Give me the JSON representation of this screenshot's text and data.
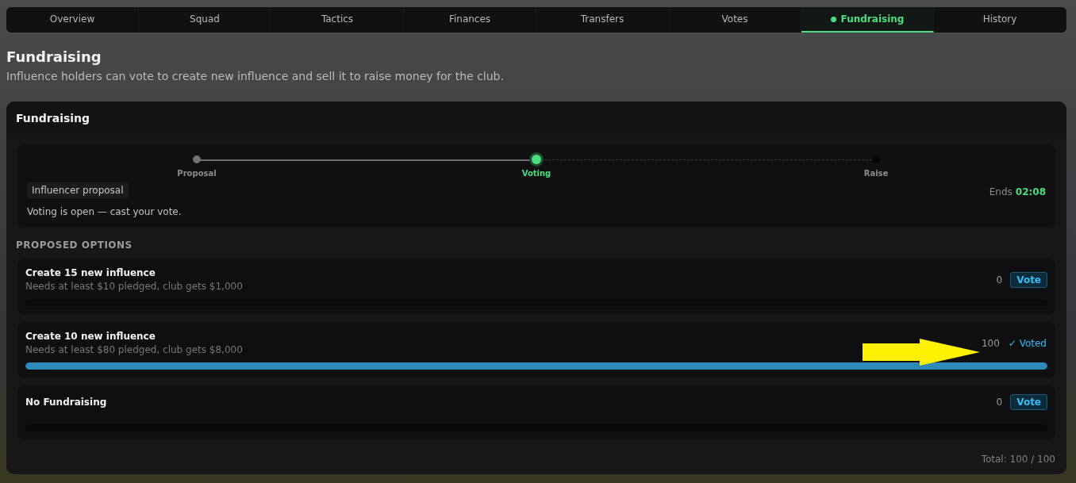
{
  "tabs": [
    {
      "label": "Overview",
      "selected": false,
      "dot": false
    },
    {
      "label": "Squad",
      "selected": false,
      "dot": false
    },
    {
      "label": "Tactics",
      "selected": false,
      "dot": false
    },
    {
      "label": "Finances",
      "selected": false,
      "dot": false
    },
    {
      "label": "Transfers",
      "selected": false,
      "dot": false
    },
    {
      "label": "Votes",
      "selected": false,
      "dot": false
    },
    {
      "label": "Fundraising",
      "selected": true,
      "dot": true
    },
    {
      "label": "History",
      "selected": false,
      "dot": false
    }
  ],
  "page": {
    "title": "Fundraising",
    "subtitle": "Influence holders can vote to create new influence and sell it to raise money for the club."
  },
  "card": {
    "title": "Fundraising",
    "stepper": {
      "steps": [
        {
          "label": "Proposal",
          "completed": true,
          "selected": false
        },
        {
          "label": "Voting",
          "completed": false,
          "selected": true
        },
        {
          "label": "Raise",
          "completed": false,
          "selected": false
        }
      ],
      "badge": "Influencer proposal",
      "ends_label": "Ends",
      "ends_time": "02:08",
      "status_text": "Voting is open — cast your vote."
    },
    "section_heading": "PROPOSED OPTIONS",
    "options": [
      {
        "title": "Create 15 new influence",
        "detail": "Needs at least $10 pledged, club gets $1,000",
        "count": "0",
        "action": "Vote",
        "voted": false,
        "level": 0
      },
      {
        "title": "Create 10 new influence",
        "detail": "Needs at least $80 pledged, club gets $8,000",
        "count": "100",
        "action": "✓ Voted",
        "voted": true,
        "level": 1
      },
      {
        "title": "No Fundraising",
        "count": "0",
        "action": "Vote",
        "voted": false,
        "level": 0
      }
    ],
    "total": "Total: 100 / 100"
  }
}
